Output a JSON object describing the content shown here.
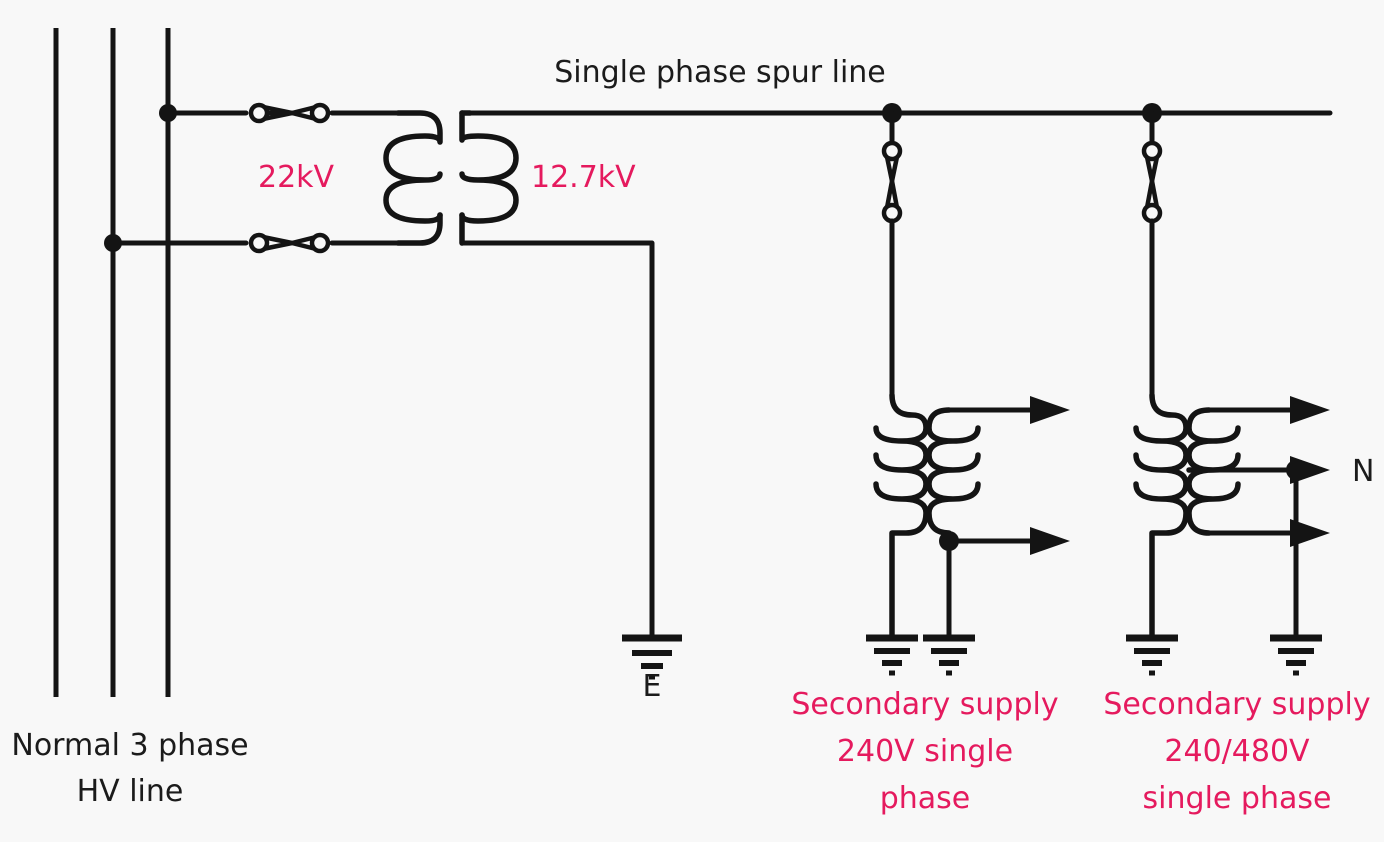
{
  "diagram": {
    "title_label": "Single phase spur line",
    "background_color": "#f8f8f8",
    "line_color": "#141414",
    "accent_color": "#e51a5e",
    "hv_line_caption_line1": "Normal 3 phase",
    "hv_line_caption_line2": "HV line",
    "primary_voltage_label": "22kV",
    "secondary_voltage_label": "12.7kV",
    "earth_label": "E",
    "neutral_label": "N",
    "supply_a": {
      "line1": "Secondary supply",
      "line2": "240V single",
      "line3": "phase"
    },
    "supply_b": {
      "line1": "Secondary supply",
      "line2": "240/480V",
      "line3": "single phase"
    },
    "icons": {
      "fuse": "fuse-icon",
      "ground": "ground-icon",
      "transformer": "transformer-icon",
      "junction": "junction-dot-icon",
      "arrow": "arrow-icon"
    }
  }
}
